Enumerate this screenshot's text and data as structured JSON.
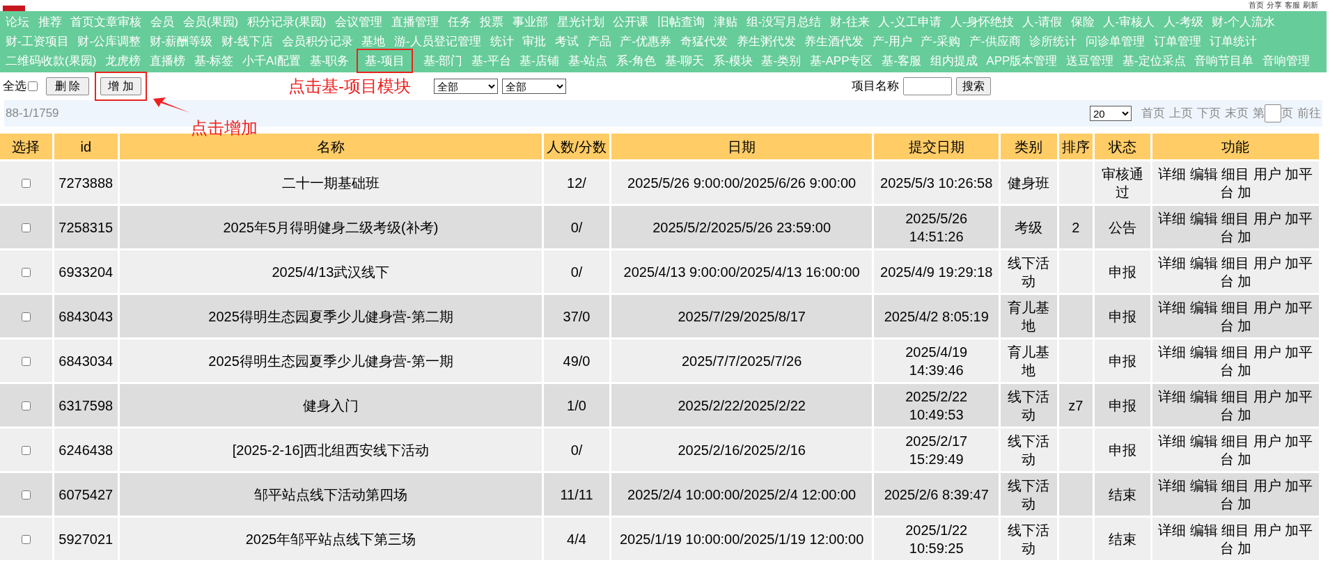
{
  "header_links": [
    "首页",
    "分享",
    "客服",
    "刷新"
  ],
  "nav": [
    {
      "label": "论坛",
      "highlighted": false
    },
    {
      "label": "推荐",
      "highlighted": false
    },
    {
      "label": "首页文章审核",
      "highlighted": false
    },
    {
      "label": "会员",
      "highlighted": false
    },
    {
      "label": "会员(果园)",
      "highlighted": false
    },
    {
      "label": "积分记录(果园)",
      "highlighted": false
    },
    {
      "label": "会议管理",
      "highlighted": false
    },
    {
      "label": "直播管理",
      "highlighted": false
    },
    {
      "label": "任务",
      "highlighted": false
    },
    {
      "label": "投票",
      "highlighted": false
    },
    {
      "label": "事业部",
      "highlighted": false
    },
    {
      "label": "星光计划",
      "highlighted": false
    },
    {
      "label": "公开课",
      "highlighted": false
    },
    {
      "label": "旧帖查询",
      "highlighted": false
    },
    {
      "label": "津贴",
      "highlighted": false
    },
    {
      "label": "组-没写月总结",
      "highlighted": false
    },
    {
      "label": "财-往来",
      "highlighted": false
    },
    {
      "label": "人-义工申请",
      "highlighted": false
    },
    {
      "label": "人-身怀绝技",
      "highlighted": false
    },
    {
      "label": "人-请假",
      "highlighted": false
    },
    {
      "label": "保险",
      "highlighted": false
    },
    {
      "label": "人-审核人",
      "highlighted": false
    },
    {
      "label": "人-考级",
      "highlighted": false
    },
    {
      "label": "财-个人流水",
      "highlighted": false
    },
    {
      "label": "财-工资项目",
      "highlighted": false
    },
    {
      "label": "财-公库调整",
      "highlighted": false
    },
    {
      "label": "财-薪酬等级",
      "highlighted": false
    },
    {
      "label": "财-线下店",
      "highlighted": false
    },
    {
      "label": "会员积分记录",
      "highlighted": false
    },
    {
      "label": "基地",
      "highlighted": false
    },
    {
      "label": "游-人员登记管理",
      "highlighted": false
    },
    {
      "label": "统计",
      "highlighted": false
    },
    {
      "label": "审批",
      "highlighted": false
    },
    {
      "label": "考试",
      "highlighted": false
    },
    {
      "label": "产品",
      "highlighted": false
    },
    {
      "label": "产-优惠券",
      "highlighted": false
    },
    {
      "label": "奇猛代发",
      "highlighted": false
    },
    {
      "label": "养生粥代发",
      "highlighted": false
    },
    {
      "label": "养生酒代发",
      "highlighted": false
    },
    {
      "label": "产-用户",
      "highlighted": false
    },
    {
      "label": "产-采购",
      "highlighted": false
    },
    {
      "label": "产-供应商",
      "highlighted": false
    },
    {
      "label": "诊所统计",
      "highlighted": false
    },
    {
      "label": "问诊单管理",
      "highlighted": false
    },
    {
      "label": "订单管理",
      "highlighted": false
    },
    {
      "label": "订单统计",
      "highlighted": false
    },
    {
      "label": "二维码收款(果园)",
      "highlighted": false
    },
    {
      "label": "龙虎榜",
      "highlighted": false
    },
    {
      "label": "直播榜",
      "highlighted": false
    },
    {
      "label": "基-标签",
      "highlighted": false
    },
    {
      "label": "小千AI配置",
      "highlighted": false
    },
    {
      "label": "基-职务",
      "highlighted": false
    },
    {
      "label": "基-项目",
      "highlighted": true
    },
    {
      "label": "基-部门",
      "highlighted": false
    },
    {
      "label": "基-平台",
      "highlighted": false
    },
    {
      "label": "基-店铺",
      "highlighted": false
    },
    {
      "label": "基-站点",
      "highlighted": false
    },
    {
      "label": "系-角色",
      "highlighted": false
    },
    {
      "label": "基-聊天",
      "highlighted": false
    },
    {
      "label": "系-模块",
      "highlighted": false
    },
    {
      "label": "基-类别",
      "highlighted": false
    },
    {
      "label": "基-APP专区",
      "highlighted": false
    },
    {
      "label": "基-客服",
      "highlighted": false
    },
    {
      "label": "组内提成",
      "highlighted": false
    },
    {
      "label": "APP版本管理",
      "highlighted": false
    },
    {
      "label": "送豆管理",
      "highlighted": false
    },
    {
      "label": "基-定位采点",
      "highlighted": false
    },
    {
      "label": "音响节目单",
      "highlighted": false
    },
    {
      "label": "音响管理",
      "highlighted": false
    }
  ],
  "toolbar": {
    "select_all": {
      "label": "全选",
      "checked": false
    },
    "delete_button": {
      "label": "删 除"
    },
    "add_button": {
      "label": "增 加",
      "highlighted": true
    },
    "filters": [
      "全部",
      "全部"
    ],
    "search_label": "项目名称",
    "search_button": "搜索"
  },
  "annotations": [
    "点击基-项目模块",
    "点击增加"
  ],
  "info_bar": {
    "count": "88-1/1759",
    "page_size": "20",
    "pager": [
      "首页",
      "上页",
      "下页",
      "末页"
    ],
    "page_prefix": "第",
    "page_suffix": "页",
    "go": "前往"
  },
  "table": {
    "columns": [
      "选择",
      "id",
      "名称",
      "人数/分数",
      "日期",
      "提交日期",
      "类别",
      "排序",
      "状态",
      "功能"
    ],
    "rows": [
      {
        "checked": false,
        "id": "7273888",
        "name": "二十一期基础班",
        "count": "12/",
        "date": "2025/5/26 9:00:00/2025/6/26 9:00:00",
        "submitted": "2025/5/3 10:26:58",
        "category": "健身班",
        "order": "",
        "status": "审核通过",
        "actions": [
          "详细",
          "编辑",
          "细目",
          "用户",
          "加平台",
          "加"
        ]
      },
      {
        "checked": false,
        "id": "7258315",
        "name": "2025年5月得明健身二级考级(补考)",
        "count": "0/",
        "date": "2025/5/2/2025/5/26 23:59:00",
        "submitted": "2025/5/26 14:51:26",
        "category": "考级",
        "order": "2",
        "status": "公告",
        "actions": [
          "详细",
          "编辑",
          "细目",
          "用户",
          "加平台",
          "加"
        ]
      },
      {
        "checked": false,
        "id": "6933204",
        "name": "2025/4/13武汉线下",
        "count": "0/",
        "date": "2025/4/13 9:00:00/2025/4/13 16:00:00",
        "submitted": "2025/4/9 19:29:18",
        "category": "线下活动",
        "order": "",
        "status": "申报",
        "actions": [
          "详细",
          "编辑",
          "细目",
          "用户",
          "加平台",
          "加"
        ]
      },
      {
        "checked": false,
        "id": "6843043",
        "name": "2025得明生态园夏季少儿健身营-第二期",
        "count": "37/0",
        "date": "2025/7/29/2025/8/17",
        "submitted": "2025/4/2 8:05:19",
        "category": "育儿基地",
        "order": "",
        "status": "申报",
        "actions": [
          "详细",
          "编辑",
          "细目",
          "用户",
          "加平台",
          "加"
        ]
      },
      {
        "checked": false,
        "id": "6843034",
        "name": "2025得明生态园夏季少儿健身营-第一期",
        "count": "49/0",
        "date": "2025/7/7/2025/7/26",
        "submitted": "2025/4/19 14:39:46",
        "category": "育儿基地",
        "order": "",
        "status": "申报",
        "actions": [
          "详细",
          "编辑",
          "细目",
          "用户",
          "加平台",
          "加"
        ]
      },
      {
        "checked": false,
        "id": "6317598",
        "name": "健身入门",
        "count": "1/0",
        "date": "2025/2/22/2025/2/22",
        "submitted": "2025/2/22 10:49:53",
        "category": "线下活动",
        "order": "z7",
        "status": "申报",
        "actions": [
          "详细",
          "编辑",
          "细目",
          "用户",
          "加平台",
          "加"
        ]
      },
      {
        "checked": false,
        "id": "6246438",
        "name": "[2025-2-16]西北组西安线下活动",
        "count": "0/",
        "date": "2025/2/16/2025/2/16",
        "submitted": "2025/2/17 15:29:49",
        "category": "线下活动",
        "order": "",
        "status": "申报",
        "actions": [
          "详细",
          "编辑",
          "细目",
          "用户",
          "加平台",
          "加"
        ]
      },
      {
        "checked": false,
        "id": "6075427",
        "name": "邹平站点线下活动第四场",
        "count": "11/11",
        "date": "2025/2/4 10:00:00/2025/2/4 12:00:00",
        "submitted": "2025/2/6 8:39:47",
        "category": "线下活动",
        "order": "",
        "status": "结束",
        "actions": [
          "详细",
          "编辑",
          "细目",
          "用户",
          "加平台",
          "加"
        ]
      },
      {
        "checked": false,
        "id": "5927021",
        "name": "2025年邹平站点线下第三场",
        "count": "4/4",
        "date": "2025/1/19 10:00:00/2025/1/19 12:00:00",
        "submitted": "2025/1/22 10:59:25",
        "category": "线下活动",
        "order": "",
        "status": "结束",
        "actions": [
          "详细",
          "编辑",
          "细目",
          "用户",
          "加平台",
          "加"
        ]
      }
    ]
  }
}
